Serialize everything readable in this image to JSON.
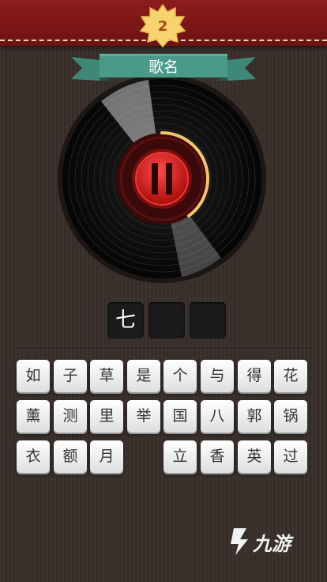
{
  "level": {
    "number": "2"
  },
  "category": {
    "label": "歌名"
  },
  "player": {
    "state": "paused",
    "progress_percent": 40
  },
  "answer": {
    "slots": [
      "七",
      "",
      ""
    ]
  },
  "keyboard": {
    "rows": [
      [
        "如",
        "子",
        "草",
        "是",
        "个",
        "与",
        "得",
        "花"
      ],
      [
        "薰",
        "测",
        "里",
        "举",
        "国",
        "八",
        "郭",
        "锅"
      ],
      [
        "衣",
        "额",
        "月",
        "",
        "立",
        "香",
        "英",
        "过"
      ]
    ]
  },
  "watermark": {
    "text": "九游"
  },
  "colors": {
    "header_red": "#8e1c1c",
    "ribbon_green": "#4a9a8a",
    "badge_yellow": "#f6d36e",
    "play_red": "#d62020",
    "progress_ring": "#f2c56c"
  }
}
